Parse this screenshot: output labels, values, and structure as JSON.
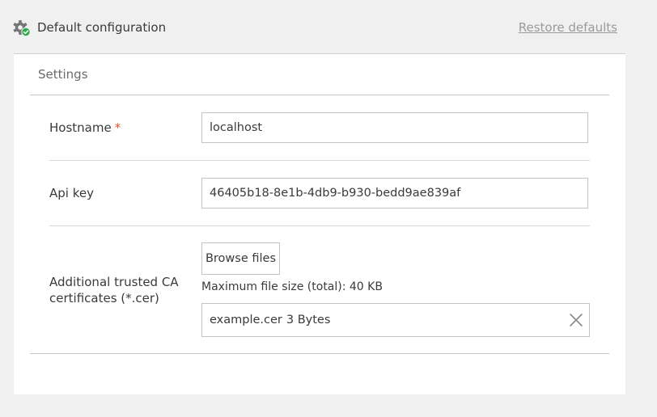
{
  "header": {
    "title": "Default configuration",
    "restore_label": "Restore defaults",
    "icon": "gear-check-icon"
  },
  "settings": {
    "section_title": "Settings",
    "hostname": {
      "label": "Hostname",
      "required_marker": "*",
      "value": "localhost"
    },
    "api_key": {
      "label": "Api key",
      "value": "46405b18-8e1b-4db9-b930-bedd9ae839af"
    },
    "certificates": {
      "label": "Additional trusted CA certificates (*.cer)",
      "browse_label": "Browse files",
      "max_size_note": "Maximum file size (total): 40 KB",
      "file_name": "example.cer",
      "file_size": "3 Bytes",
      "remove_icon": "close-icon"
    }
  },
  "colors": {
    "required": "#e0522c",
    "check_badge": "#2eab4b",
    "link": "#9a9a9a",
    "background": "#f0f0f0"
  }
}
